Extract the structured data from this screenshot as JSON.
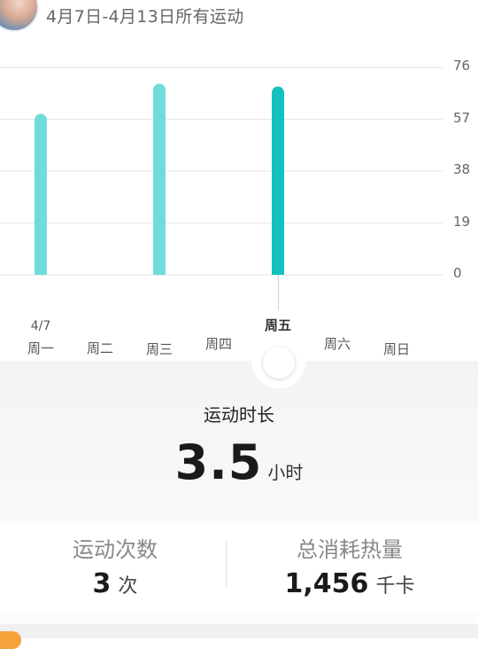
{
  "header": {
    "title": "4月7日-4月13日所有运动"
  },
  "colors": {
    "bar": "#6fdbdb",
    "bar_selected": "#14c1c1",
    "grid": "#e6e6e6",
    "accent_orange": "#f6a23a"
  },
  "chart_data": {
    "type": "bar",
    "categories": [
      "周一",
      "周二",
      "周三",
      "周四",
      "周五",
      "周六",
      "周日"
    ],
    "values": [
      59,
      0,
      70,
      0,
      69,
      0,
      0
    ],
    "y_ticks": [
      "76",
      "57",
      "38",
      "19",
      "0"
    ],
    "ylim": [
      0,
      76
    ],
    "selected_index": 4,
    "date_label": "4/7",
    "grid": true
  },
  "summary": {
    "title": "运动时长",
    "value": "3.5",
    "unit": "小时"
  },
  "stats": {
    "count_label": "运动次数",
    "count_value": "3",
    "count_unit": "次",
    "calorie_label": "总消耗热量",
    "calorie_value": "1,456",
    "calorie_unit": "千卡"
  }
}
